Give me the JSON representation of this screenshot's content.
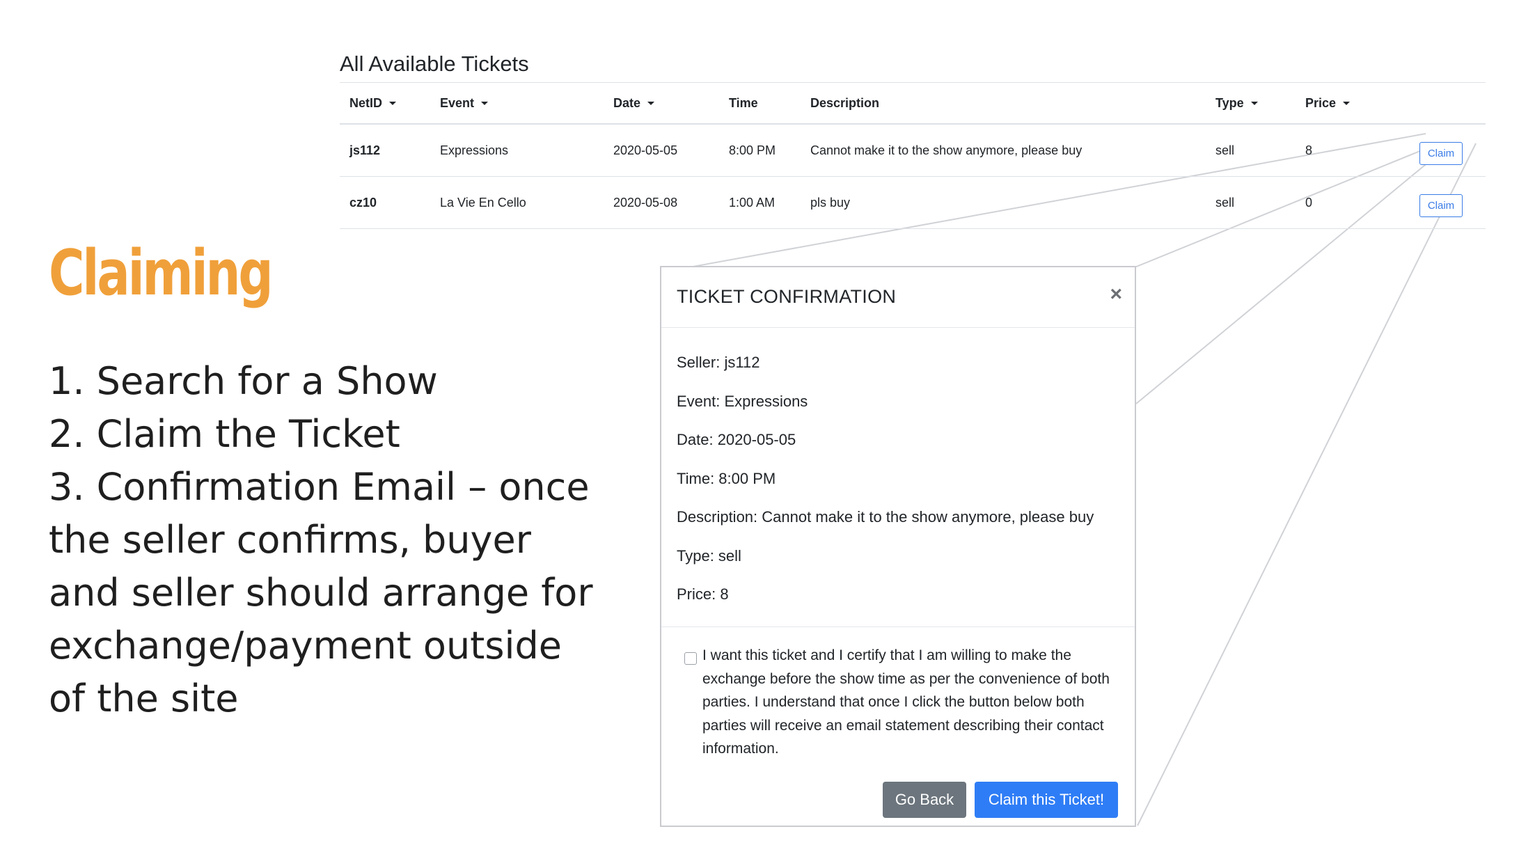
{
  "tickets": {
    "title": "All Available Tickets",
    "columns": [
      {
        "label": "NetID",
        "sortable": true
      },
      {
        "label": "Event",
        "sortable": true
      },
      {
        "label": "Date",
        "sortable": true
      },
      {
        "label": "Time",
        "sortable": false
      },
      {
        "label": "Description",
        "sortable": false
      },
      {
        "label": "Type",
        "sortable": true
      },
      {
        "label": "Price",
        "sortable": true
      },
      {
        "label": "",
        "sortable": false
      }
    ],
    "rows": [
      {
        "netid": "js112",
        "event": "Expressions",
        "date": "2020-05-05",
        "time": "8:00 PM",
        "description": "Cannot make it to the show anymore, please buy",
        "type": "sell",
        "price": "8",
        "action": "Claim"
      },
      {
        "netid": "cz10",
        "event": "La Vie En Cello",
        "date": "2020-05-08",
        "time": "1:00 AM",
        "description": "pls buy",
        "type": "sell",
        "price": "0",
        "action": "Claim"
      }
    ]
  },
  "slide": {
    "heading": "Claiming",
    "steps": [
      "1. Search for a Show",
      "2. Claim the Ticket",
      "3. Confirmation Email – once the seller confirms, buyer and seller should arrange for exchange/payment outside of the site"
    ]
  },
  "modal": {
    "title": "TICKET CONFIRMATION",
    "close_label": "×",
    "details": [
      "Seller: js112",
      "Event: Expressions",
      "Date: 2020-05-05",
      "Time: 8:00 PM",
      "Description: Cannot make it to the show anymore, please buy",
      "Type: sell",
      "Price: 8"
    ],
    "consent_text": "I want this ticket and I certify that I am willing to make the exchange before the show time as per the convenience of both parties. I understand that once I click the button below both parties will receive an email statement describing their contact information.",
    "back_label": "Go Back",
    "claim_label": "Claim this Ticket!"
  },
  "colors": {
    "heading": "#f0a03a",
    "primary": "#2f7df6",
    "secondary": "#6c757d",
    "connector": "#d0d2d6"
  }
}
